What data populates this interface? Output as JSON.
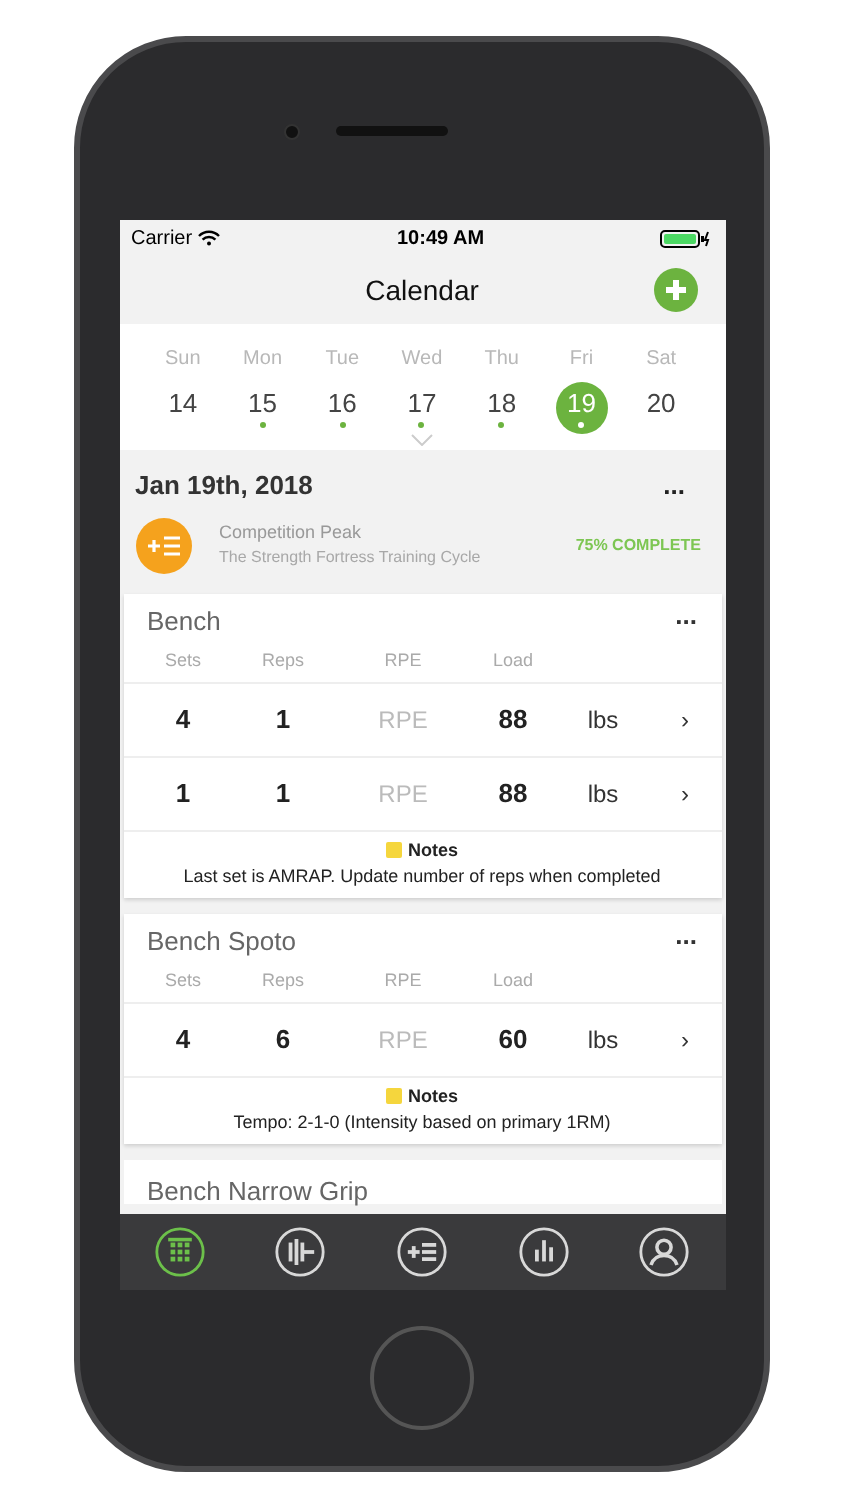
{
  "status_bar": {
    "carrier": "Carrier",
    "time": "10:49 AM"
  },
  "nav": {
    "title": "Calendar"
  },
  "week": [
    {
      "day": "Sun",
      "date": "14",
      "has_event": false,
      "selected": false
    },
    {
      "day": "Mon",
      "date": "15",
      "has_event": true,
      "selected": false
    },
    {
      "day": "Tue",
      "date": "16",
      "has_event": true,
      "selected": false
    },
    {
      "day": "Wed",
      "date": "17",
      "has_event": true,
      "selected": false
    },
    {
      "day": "Thu",
      "date": "18",
      "has_event": true,
      "selected": false
    },
    {
      "day": "Fri",
      "date": "19",
      "has_event": true,
      "selected": true
    },
    {
      "day": "Sat",
      "date": "20",
      "has_event": false,
      "selected": false
    }
  ],
  "day_header": {
    "date": "Jan 19th, 2018",
    "more": "...",
    "program": "Competition Peak",
    "cycle": "The Strength Fortress Training Cycle",
    "progress": "75% COMPLETE"
  },
  "exercises": [
    {
      "name": "Bench",
      "more": "...",
      "columns": [
        "Sets",
        "Reps",
        "RPE",
        "Load"
      ],
      "rows": [
        {
          "sets": "4",
          "reps": "1",
          "rpe": "RPE",
          "load": "88",
          "unit": "lbs",
          "chevron": "›"
        },
        {
          "sets": "1",
          "reps": "1",
          "rpe": "RPE",
          "load": "88",
          "unit": "lbs",
          "chevron": "›"
        }
      ],
      "notes_label": "Notes",
      "notes": "Last set is AMRAP. Update number of reps when completed"
    },
    {
      "name": "Bench Spoto",
      "more": "...",
      "columns": [
        "Sets",
        "Reps",
        "RPE",
        "Load"
      ],
      "rows": [
        {
          "sets": "4",
          "reps": "6",
          "rpe": "RPE",
          "load": "60",
          "unit": "lbs",
          "chevron": "›"
        }
      ],
      "notes_label": "Notes",
      "notes": "Tempo: 2-1-0  (Intensity based on primary 1RM)"
    },
    {
      "name": "Bench Narrow Grip"
    }
  ],
  "tab_bar": [
    {
      "kind": "calendar",
      "selected": true
    },
    {
      "kind": "exercises",
      "selected": false
    },
    {
      "kind": "programs",
      "selected": false
    },
    {
      "kind": "stats",
      "selected": false
    },
    {
      "kind": "profile",
      "selected": false
    }
  ]
}
